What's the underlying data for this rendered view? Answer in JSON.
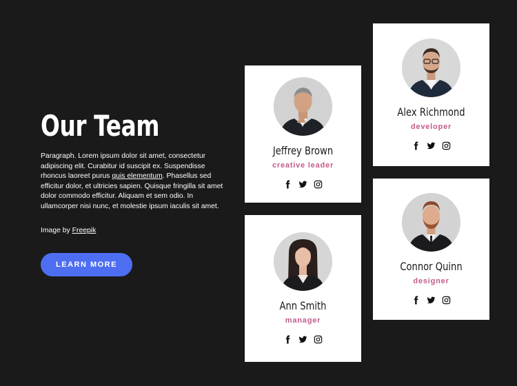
{
  "section": {
    "title": "Our Team",
    "paragraph_part1": "Paragraph. Lorem ipsum dolor sit amet, consectetur adipiscing elit. Curabitur id suscipit ex. Suspendisse rhoncus laoreet purus ",
    "paragraph_link": "quis elementum",
    "paragraph_part2": ". Phasellus sed efficitur dolor, et ultricies sapien. Quisque fringilla sit amet dolor commodo efficitur. Aliquam et sem odio. In ullamcorper nisi nunc, et molestie ipsum iaculis sit amet.",
    "credit_prefix": "Image by ",
    "credit_link": "Freepik",
    "button_label": "LEARN MORE"
  },
  "members": [
    {
      "name": "Jeffrey Brown",
      "role": "creative leader"
    },
    {
      "name": "Ann Smith",
      "role": "manager"
    },
    {
      "name": "Alex Richmond",
      "role": "developer"
    },
    {
      "name": "Connor Quinn",
      "role": "designer"
    }
  ],
  "icons": {
    "facebook": "facebook-icon",
    "twitter": "twitter-icon",
    "instagram": "instagram-icon"
  },
  "colors": {
    "background": "#1a1a1a",
    "button": "#4e6ef2",
    "role": "#c25b8a",
    "card": "#ffffff"
  }
}
